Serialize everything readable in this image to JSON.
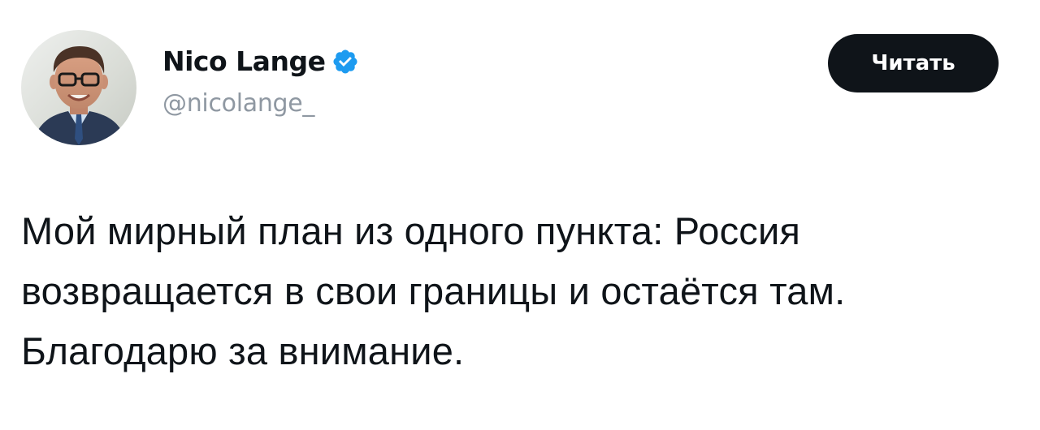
{
  "author": {
    "display_name": "Nico Lange",
    "handle": "@nicolange_",
    "verified_icon": "verified-badge-icon",
    "verified_color": "#1d9bf0"
  },
  "follow_button": {
    "label": "Читать",
    "background": "#0f1419",
    "text_color": "#ffffff"
  },
  "tweet": {
    "lines": [
      "Мой мирный план из одного пункта: Россия",
      "возвращается в свои границы и остаётся там.",
      "Благодарю за внимание."
    ]
  },
  "colors": {
    "text": "#0f1419",
    "handle": "#8f98a2",
    "background": "#ffffff"
  }
}
